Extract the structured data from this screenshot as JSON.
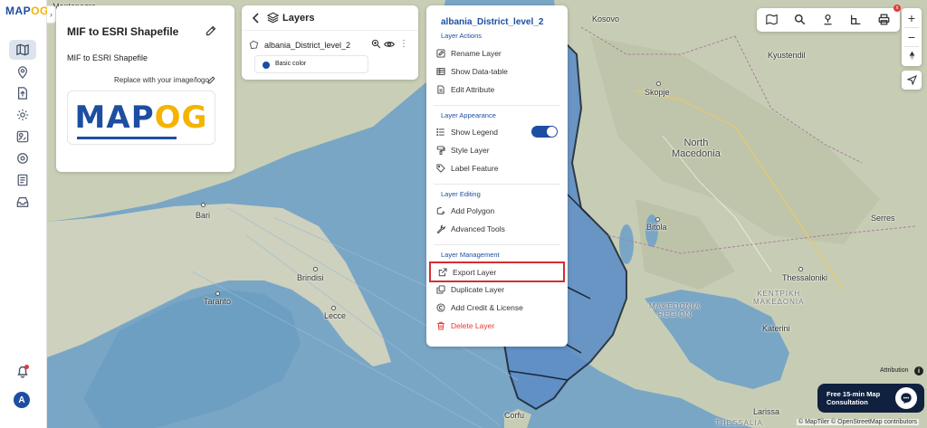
{
  "app": {
    "logo_main": "MAP",
    "logo_accent": "OG"
  },
  "sidebar": {
    "icons": [
      "map-icon",
      "location-pin-icon",
      "upload-file-icon",
      "gear-icon",
      "analytics-icon",
      "settings-icon",
      "report-icon",
      "inbox-icon"
    ],
    "avatar_initial": "A"
  },
  "project": {
    "title": "MIF to ESRI Shapefile",
    "description": "MIF to ESRI Shapefile",
    "replace_label": "Replace with your image/logo",
    "brand_logo_main": "MAP",
    "brand_logo_accent": "OG"
  },
  "layers_panel": {
    "title": "Layers",
    "layer_name": "albania_District_level_2",
    "style_label": "Basic color",
    "style_color": "#1a4ea3"
  },
  "layer_menu": {
    "title": "albania_District_level_2",
    "sections": {
      "actions": "Layer Actions",
      "appearance": "Layer Appearance",
      "editing": "Layer Editing",
      "management": "Layer Management"
    },
    "items": {
      "rename": "Rename Layer",
      "datatable": "Show Data-table",
      "edit_attr": "Edit Attribute",
      "legend": "Show Legend",
      "style": "Style Layer",
      "label": "Label Feature",
      "polygon": "Add Polygon",
      "advanced": "Advanced Tools",
      "export": "Export Layer",
      "duplicate": "Duplicate Layer",
      "credit": "Add Credit & License",
      "delete": "Delete Layer"
    },
    "show_legend_on": true
  },
  "map": {
    "labels": {
      "montenegro": "Montenegro",
      "kosovo": "Kosovo",
      "kyustendil": "Kyustendil",
      "skopje": "Skopje",
      "north_macedonia": "North\nMacedonia",
      "bari": "Bari",
      "brindisi": "Brindisi",
      "taranto": "Taranto",
      "lecce": "Lecce",
      "bitola": "Bitola",
      "serres": "Serres",
      "thessaloniki": "Thessaloniki",
      "kentriki": "ΚΕΝΤΡΙΚΗ\nΜΑΚΕΔΟΝΙΑ",
      "makedonia_region": "MAKEDONIA\nREGION",
      "katerini": "Katerini",
      "larissa": "Larissa",
      "corfu": "Corfu",
      "thessalia": "THESSALIA"
    }
  },
  "controls": {
    "attribution": "Attribution",
    "consult": "Free 15-min Map Consultation",
    "copyright": "© MapTiler © OpenStreetMap contributors",
    "notification_badge": "x"
  }
}
